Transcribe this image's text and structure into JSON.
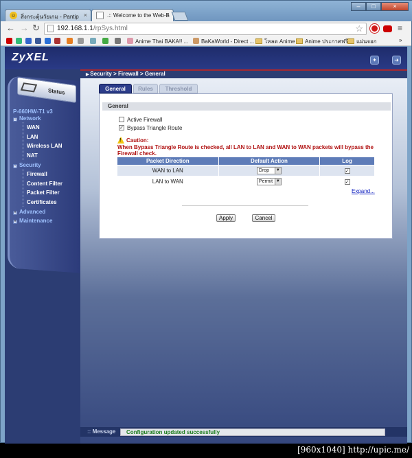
{
  "browser": {
    "tabs": [
      {
        "label": "สิ่งกระตุ้นวัยเกม - Pantip",
        "active": false
      },
      {
        "label": ".:: Welcome to the Web-B",
        "active": true
      }
    ],
    "url_host": "192.168.1.1",
    "url_path": "/rpSys.html",
    "bookmarks": [
      "Anime Thai BAKA!! ...",
      "BaKaWorld - Direct ...",
      "โหลด Anime",
      "Anime ประกาศฟรี",
      "แผ่นจอก"
    ],
    "bookmarks_overflow": "»"
  },
  "app": {
    "logo": "ZyXEL",
    "breadcrumb": "Security > Firewall > General"
  },
  "sidebar": {
    "status_label": "Status",
    "model": "P-660HW-T1 v3",
    "network": "Network",
    "network_items": [
      "WAN",
      "LAN",
      "Wireless LAN",
      "NAT"
    ],
    "security": "Security",
    "security_items": [
      "Firewall",
      "Content Filter",
      "Packet Filter",
      "Certificates"
    ],
    "advanced": "Advanced",
    "maintenance": "Maintenance"
  },
  "panel": {
    "tabs": [
      "General",
      "Rules",
      "Threshold"
    ],
    "section_title": "General",
    "active_firewall_label": "Active Firewall",
    "active_firewall_checked": false,
    "bypass_label": "Bypass Triangle Route",
    "bypass_checked": true,
    "caution_title": "Caution:",
    "caution_text": "When Bypass Triangle Route is checked, all LAN to LAN and WAN to WAN packets will bypass the Firewall check.",
    "table": {
      "headers": [
        "Packet Direction",
        "Default Action",
        "Log"
      ],
      "rows": [
        {
          "direction": "WAN to LAN",
          "action": "Drop",
          "log": true
        },
        {
          "direction": "LAN to WAN",
          "action": "Permit",
          "log": true
        }
      ]
    },
    "expand_link": "Expand...",
    "apply": "Apply",
    "cancel": "Cancel"
  },
  "message": {
    "label": "Message",
    "text": "Configuration updated successfully"
  },
  "footer": "[960x1040] http://upic.me/"
}
